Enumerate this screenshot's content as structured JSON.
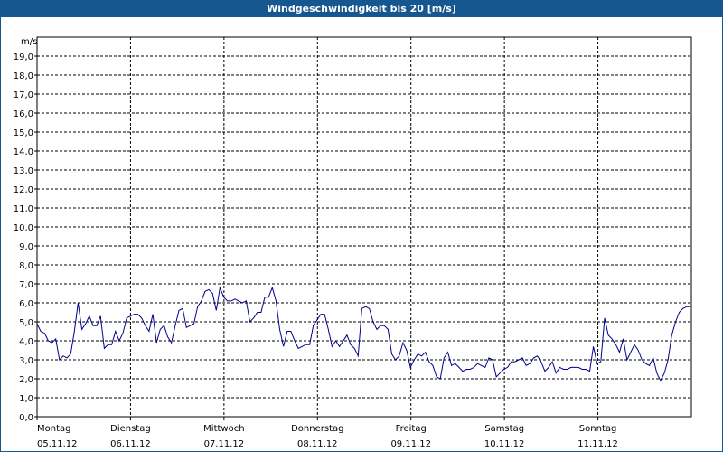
{
  "window": {
    "title": "Windgeschwindigkeit bis 20 [m/s]"
  },
  "chart_data": {
    "type": "line",
    "title": "Windgeschwindigkeit bis 20 [m/s]",
    "ylabel": "m/s",
    "ylim": [
      0,
      20
    ],
    "y_ticks": [
      "0,0",
      "1,0",
      "2,0",
      "3,0",
      "4,0",
      "5,0",
      "6,0",
      "7,0",
      "8,0",
      "9,0",
      "10,0",
      "11,0",
      "12,0",
      "13,0",
      "14,0",
      "15,0",
      "16,0",
      "17,0",
      "18,0",
      "19,0"
    ],
    "x_days": [
      {
        "day": "Montag",
        "date": "05.11.12"
      },
      {
        "day": "Dienstag",
        "date": "06.11.12"
      },
      {
        "day": "Mittwoch",
        "date": "07.11.12"
      },
      {
        "day": "Donnerstag",
        "date": "08.11.12"
      },
      {
        "day": "Freitag",
        "date": "09.11.12"
      },
      {
        "day": "Samstag",
        "date": "10.11.12"
      },
      {
        "day": "Sonntag",
        "date": "11.11.12"
      }
    ],
    "grid": true,
    "line_color": "#00008b",
    "series": [
      {
        "values": [
          4.9,
          4.5,
          4.4,
          4.0,
          3.9,
          4.1,
          3.0,
          3.2,
          3.1,
          3.3,
          4.5,
          6.0,
          4.6,
          4.9,
          5.3,
          4.8,
          4.8,
          5.3,
          3.6,
          3.8,
          3.8,
          4.5,
          4.0,
          4.4,
          5.2,
          5.3,
          5.4,
          5.4,
          5.2,
          4.8,
          4.5,
          5.4,
          3.9,
          4.6,
          4.8,
          4.2,
          3.9,
          4.8,
          5.6,
          5.7,
          4.7,
          4.8,
          4.9,
          5.8,
          6.1,
          6.6,
          6.7,
          6.5,
          5.6,
          6.8,
          6.3,
          6.1,
          6.1,
          6.2,
          6.1,
          6.0,
          6.1,
          5.0,
          5.2,
          5.5,
          5.5,
          6.3,
          6.3,
          6.8,
          6.1,
          4.6,
          3.7,
          4.5,
          4.5,
          4.0,
          3.6,
          3.7,
          3.8,
          3.8,
          4.8,
          5.1,
          5.4,
          5.4,
          4.6,
          3.7,
          4.0,
          3.7,
          4.0,
          4.3,
          3.8,
          3.6,
          3.2,
          5.7,
          5.8,
          5.7,
          5.0,
          4.6,
          4.8,
          4.8,
          4.6,
          3.3,
          3.0,
          3.2,
          3.9,
          3.5,
          2.6,
          3.0,
          3.3,
          3.2,
          3.4,
          2.9,
          2.7,
          2.1,
          2.0,
          3.1,
          3.4,
          2.7,
          2.8,
          2.6,
          2.4,
          2.5,
          2.5,
          2.6,
          2.8,
          2.7,
          2.6,
          3.1,
          3.0,
          2.1,
          2.3,
          2.5,
          2.6,
          2.9,
          2.9,
          3.0,
          3.1,
          2.7,
          2.8,
          3.1,
          3.2,
          2.9,
          2.4,
          2.6,
          2.9,
          2.3,
          2.6,
          2.5,
          2.5,
          2.6,
          2.6,
          2.6,
          2.5,
          2.5,
          2.4,
          3.7,
          2.8,
          2.9,
          5.2,
          4.3,
          4.1,
          3.8,
          3.4,
          4.1,
          3.0,
          3.4,
          3.8,
          3.5,
          3.0,
          2.8,
          2.7,
          3.1,
          2.3,
          1.9,
          2.3,
          3.0,
          4.3,
          5.0,
          5.5,
          5.7,
          5.8,
          5.8
        ]
      }
    ]
  }
}
